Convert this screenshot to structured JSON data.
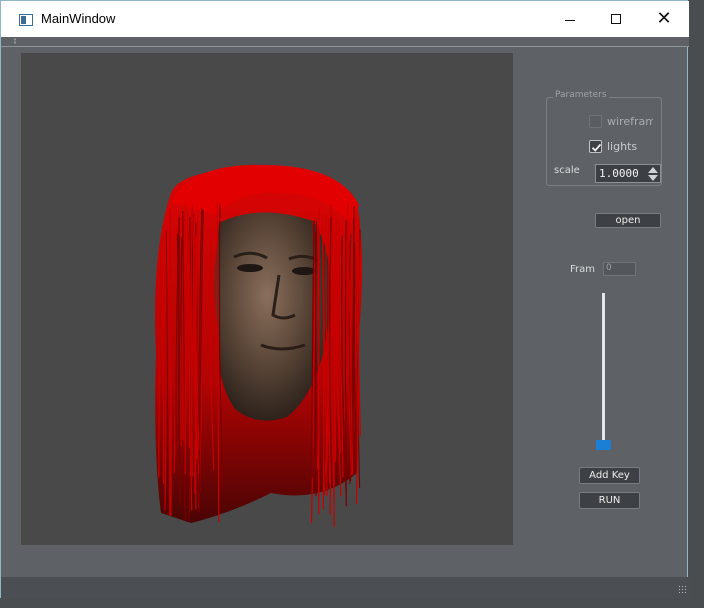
{
  "window": {
    "title": "MainWindow",
    "controls": {
      "minimize_icon": "minimize-icon",
      "maximize_icon": "maximize-icon",
      "close_label": "✕"
    }
  },
  "viewport": {
    "content": "3D head model with red hair strands",
    "background": "#494949",
    "hair_color": "#e00000"
  },
  "parameters": {
    "title": "Parameters",
    "wireframe": {
      "label": "wireframe",
      "checked": false
    },
    "lights": {
      "label": "lights",
      "checked": true
    },
    "scale": {
      "label": "scale",
      "value": "1.0000"
    }
  },
  "open_button": {
    "label": "open"
  },
  "frame": {
    "label": "Fram",
    "value": "0"
  },
  "slider": {
    "value": 0,
    "accent": "#1c7fd6"
  },
  "add_key_button": {
    "label": "Add Key"
  },
  "run_button": {
    "label": "RUN"
  }
}
